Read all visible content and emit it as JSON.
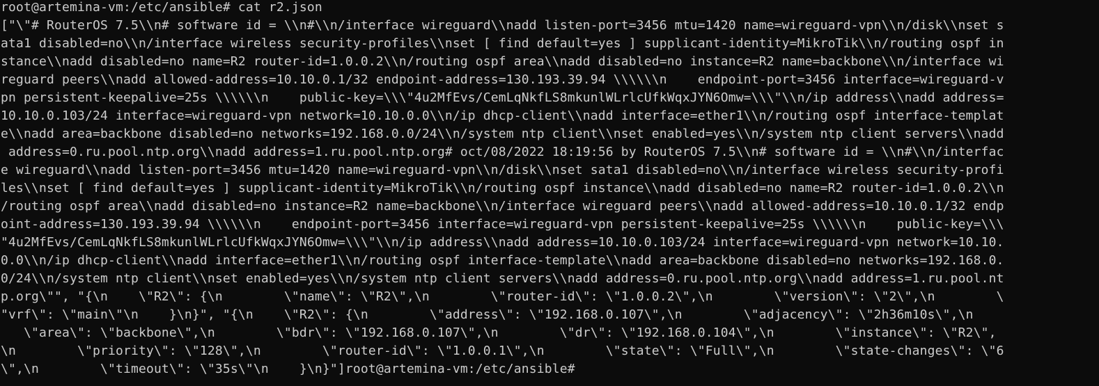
{
  "terminal": {
    "lines": [
      "root@artemina-vm:/etc/ansible# cat r2.json",
      "[\"\\\"# RouterOS 7.5\\\\n# software id = \\\\n#\\\\n/interface wireguard\\\\nadd listen-port=3456 mtu=1420 name=wireguard-vpn\\\\n/disk\\\\nset s",
      "ata1 disabled=no\\\\n/interface wireless security-profiles\\\\nset [ find default=yes ] supplicant-identity=MikroTik\\\\n/routing ospf in",
      "stance\\\\nadd disabled=no name=R2 router-id=1.0.0.2\\\\n/routing ospf area\\\\nadd disabled=no instance=R2 name=backbone\\\\n/interface wi",
      "reguard peers\\\\nadd allowed-address=10.10.0.1/32 endpoint-address=130.193.39.94 \\\\\\\\\\\\n    endpoint-port=3456 interface=wireguard-v",
      "pn persistent-keepalive=25s \\\\\\\\\\\\n    public-key=\\\\\\\"4u2MfEvs/CemLqNkfLS8mkunlWLrlcUfkWqxJYN6Omw=\\\\\\\"\\\\n/ip address\\\\nadd address=",
      "10.10.0.103/24 interface=wireguard-vpn network=10.10.0.0\\\\n/ip dhcp-client\\\\nadd interface=ether1\\\\n/routing ospf interface-templat",
      "e\\\\nadd area=backbone disabled=no networks=192.168.0.0/24\\\\n/system ntp client\\\\nset enabled=yes\\\\n/system ntp client servers\\\\nadd",
      " address=0.ru.pool.ntp.org\\\\nadd address=1.ru.pool.ntp.org# oct/08/2022 18:19:56 by RouterOS 7.5\\\\n# software id = \\\\n#\\\\n/interfac",
      "e wireguard\\\\nadd listen-port=3456 mtu=1420 name=wireguard-vpn\\\\n/disk\\\\nset sata1 disabled=no\\\\n/interface wireless security-profi",
      "les\\\\nset [ find default=yes ] supplicant-identity=MikroTik\\\\n/routing ospf instance\\\\nadd disabled=no name=R2 router-id=1.0.0.2\\\\n",
      "/routing ospf area\\\\nadd disabled=no instance=R2 name=backbone\\\\n/interface wireguard peers\\\\nadd allowed-address=10.10.0.1/32 endp",
      "oint-address=130.193.39.94 \\\\\\\\\\\\n    endpoint-port=3456 interface=wireguard-vpn persistent-keepalive=25s \\\\\\\\\\\\n    public-key=\\\\\\",
      "\"4u2MfEvs/CemLqNkfLS8mkunlWLrlcUfkWqxJYN6Omw=\\\\\\\"\\\\n/ip address\\\\nadd address=10.10.0.103/24 interface=wireguard-vpn network=10.10.",
      "0.0\\\\n/ip dhcp-client\\\\nadd interface=ether1\\\\n/routing ospf interface-template\\\\nadd area=backbone disabled=no networks=192.168.0.",
      "0/24\\\\n/system ntp client\\\\nset enabled=yes\\\\n/system ntp client servers\\\\nadd address=0.ru.pool.ntp.org\\\\nadd address=1.ru.pool.nt",
      "p.org\\\"\", \"{\\n    \\\"R2\\\": {\\n        \\\"name\\\": \\\"R2\\\",\\n        \\\"router-id\\\": \\\"1.0.0.2\\\",\\n        \\\"version\\\": \\\"2\\\",\\n        \\",
      "\"vrf\\\": \\\"main\\\"\\n    }\\n}\", \"{\\n    \\\"R2\\\": {\\n        \\\"address\\\": \\\"192.168.0.107\\\",\\n        \\\"adjacency\\\": \\\"2h36m10s\\\",\\n     ",
      "   \\\"area\\\": \\\"backbone\\\",\\n        \\\"bdr\\\": \\\"192.168.0.107\\\",\\n        \\\"dr\\\": \\\"192.168.0.104\\\",\\n        \\\"instance\\\": \\\"R2\\\",",
      "\\n        \\\"priority\\\": \\\"128\\\",\\n        \\\"router-id\\\": \\\"1.0.0.1\\\",\\n        \\\"state\\\": \\\"Full\\\",\\n        \\\"state-changes\\\": \\\"6",
      "\\\",\\n        \\\"timeout\\\": \\\"35s\\\"\\n    }\\n}\"]root@artemina-vm:/etc/ansible# "
    ]
  }
}
